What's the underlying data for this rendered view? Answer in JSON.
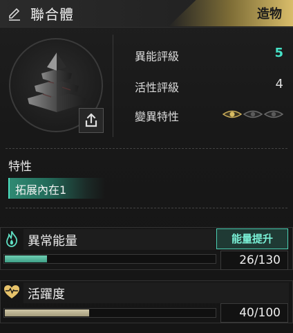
{
  "header": {
    "title": "聯合體",
    "type_label": "造物",
    "edit_icon": "pencil-icon"
  },
  "stats": [
    {
      "label": "異能評級",
      "value": "5"
    },
    {
      "label": "活性評級",
      "value": "4"
    },
    {
      "label": "變異特性",
      "value": ""
    }
  ],
  "mutation": {
    "active": 1,
    "total": 3
  },
  "traits": {
    "title": "特性",
    "items": [
      "拓展內在1"
    ]
  },
  "energy": {
    "label": "異常能量",
    "upgrade_label": "能量提升",
    "current": 26,
    "max": 130,
    "text": "26/130",
    "icon": "flame-icon"
  },
  "activity": {
    "label": "活躍度",
    "current": 40,
    "max": 100,
    "text": "40/100",
    "icon": "heart-pulse-icon"
  },
  "colors": {
    "accent_teal": "#46e3c8",
    "badge_gold": "#d9bd6a",
    "activity_fill": "#b8b090"
  }
}
